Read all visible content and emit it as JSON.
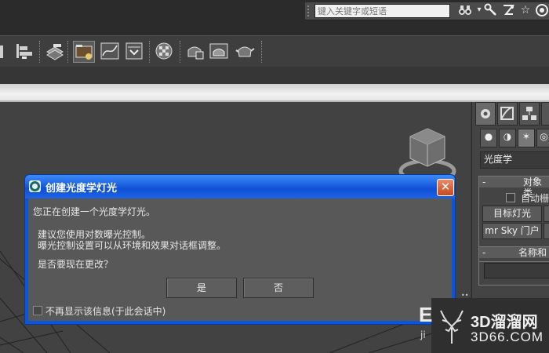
{
  "search": {
    "placeholder": "键入关键字或短语"
  },
  "toolbar_icons": [
    "align-icon",
    "layer-icon",
    "scene-explorer-icon",
    "curve-editor-icon",
    "schematic-view-icon",
    "material-editor-icon",
    "render-setup-icon",
    "rendered-frame-icon",
    "render-teapot-icon"
  ],
  "viewport_bg": "#424242",
  "command_panel": {
    "dropdown_value": "光度学",
    "object_type_header": "对象类",
    "autogrid_label": "自动栅",
    "buttons": [
      "目标灯光",
      "mr Sky 门户"
    ],
    "name_color_header": "名称和"
  },
  "dialog": {
    "title": "创建光度学灯光",
    "line1": "您正在创建一个光度学灯光。",
    "line2": "建议您使用对数曝光控制。",
    "line3": "曝光控制设置可以从环境和效果对话框调整。",
    "line4": "是否要现在更改？",
    "yes_label": "是",
    "no_label": "否",
    "checkbox_label": "不再显示该信息(于此会话中)",
    "close_glyph": "✕"
  },
  "watermark": {
    "brand": "3D溜溜网",
    "domain": "3D66.COM",
    "partial_left": "E",
    "partial_sub": "ji"
  },
  "colors": {
    "title_bar": "#0b55d8",
    "close_button": "#d0522a",
    "panel_bg": "#444444",
    "dialog_body": "#585858"
  }
}
